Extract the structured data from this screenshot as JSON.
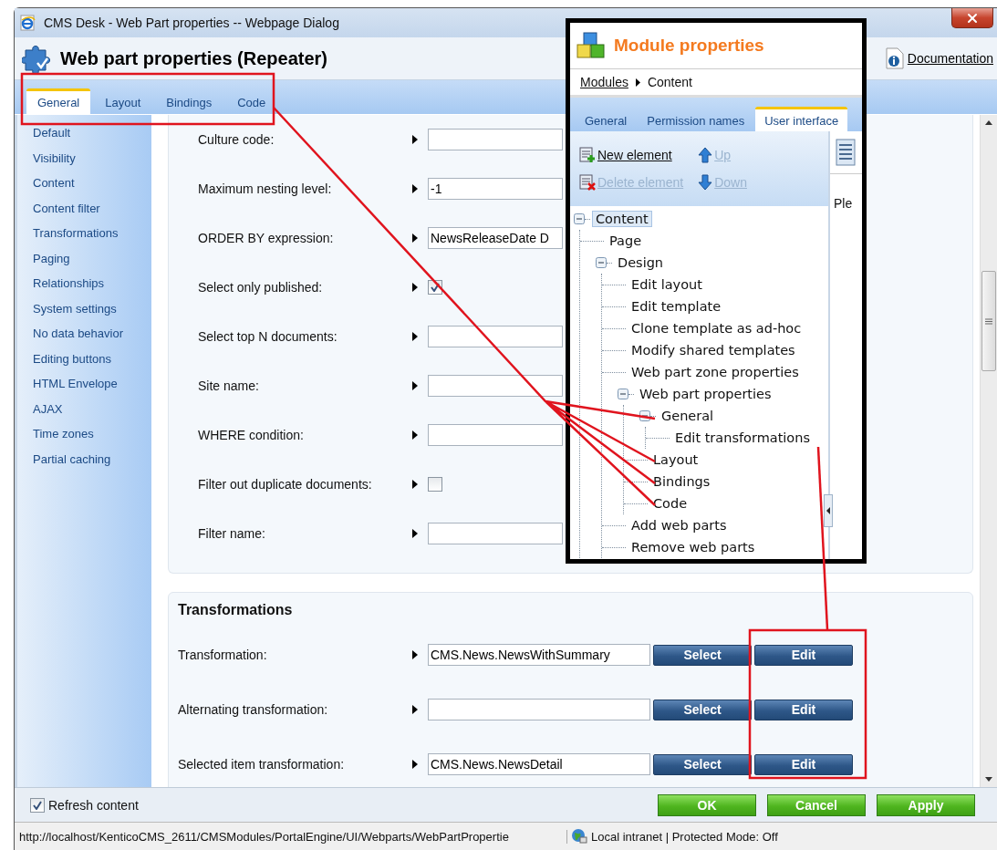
{
  "window": {
    "title": "CMS Desk - Web Part properties -- Webpage Dialog"
  },
  "header": {
    "title": "Web part properties (Repeater)",
    "help_link": "Documentation"
  },
  "tabs": [
    {
      "label": "General",
      "selected": true
    },
    {
      "label": "Layout",
      "selected": false
    },
    {
      "label": "Bindings",
      "selected": false
    },
    {
      "label": "Code",
      "selected": false
    }
  ],
  "sidebar": {
    "items": [
      "Default",
      "Visibility",
      "Content",
      "Content filter",
      "Transformations",
      "Paging",
      "Relationships",
      "System settings",
      "No data behavior",
      "Editing buttons",
      "HTML Envelope",
      "AJAX",
      "Time zones",
      "Partial caching"
    ]
  },
  "properties": [
    {
      "kind": "text",
      "label": "Culture code:"
    },
    {
      "kind": "text",
      "label": "Maximum nesting level:",
      "value": "-1"
    },
    {
      "kind": "text",
      "label": "ORDER BY expression:",
      "value": "NewsReleaseDate D"
    },
    {
      "kind": "checkbox",
      "label": "Select only published:",
      "checked": true
    },
    {
      "kind": "text",
      "label": "Select top N documents:"
    },
    {
      "kind": "text",
      "label": "Site name:"
    },
    {
      "kind": "text",
      "label": "WHERE condition:"
    },
    {
      "kind": "checkbox",
      "label": "Filter out duplicate documents:",
      "checked": false
    },
    {
      "kind": "text",
      "label": "Filter name:"
    }
  ],
  "transformations": {
    "title": "Transformations",
    "rows": [
      {
        "label": "Transformation:",
        "value": "CMS.News.NewsWithSummary",
        "select_button": "Select",
        "edit_button": "Edit"
      },
      {
        "label": "Alternating transformation:",
        "select_button": "Select",
        "edit_button": "Edit"
      },
      {
        "label": "Selected item transformation:",
        "value": "CMS.News.NewsDetail",
        "select_button": "Select",
        "edit_button": "Edit"
      }
    ]
  },
  "footer": {
    "refresh": {
      "label": "Refresh content",
      "checked": true
    },
    "buttons": [
      "OK",
      "Cancel",
      "Apply"
    ]
  },
  "status_bar": {
    "url": "http://localhost/KenticoCMS_2611/CMSModules/PortalEngine/UI/Webparts/WebPartPropertie",
    "zone": "Local intranet | Protected Mode: Off"
  },
  "inset": {
    "title": "Module properties",
    "breadcrumb": [
      "Modules",
      "Content"
    ],
    "tabs": [
      {
        "label": "General",
        "selected": false
      },
      {
        "label": "Permission names",
        "selected": false
      },
      {
        "label": "User interface",
        "selected": true
      }
    ],
    "toolbar": [
      {
        "kind": "new",
        "label": "New element",
        "disabled": false
      },
      {
        "kind": "up",
        "label": "Up",
        "disabled": true
      },
      {
        "kind": "delete",
        "label": "Delete element",
        "disabled": true
      },
      {
        "kind": "down",
        "label": "Down",
        "disabled": true
      }
    ],
    "tree": [
      {
        "label": "Content",
        "selected": true,
        "expanded": true,
        "children": [
          {
            "label": "Page",
            "selected": false
          },
          {
            "label": "Design",
            "selected": false,
            "expanded": true,
            "children": [
              {
                "label": "Edit layout",
                "selected": false
              },
              {
                "label": "Edit template",
                "selected": false
              },
              {
                "label": "Clone template as ad-hoc",
                "selected": false
              },
              {
                "label": "Modify shared templates",
                "selected": false
              },
              {
                "label": "Web part zone properties",
                "selected": false
              },
              {
                "label": "Web part properties",
                "selected": false,
                "expanded": true,
                "children": [
                  {
                    "label": "General",
                    "selected": false,
                    "expanded": true,
                    "children": [
                      {
                        "label": "Edit transformations",
                        "selected": false
                      }
                    ]
                  },
                  {
                    "label": "Layout",
                    "selected": false
                  },
                  {
                    "label": "Bindings",
                    "selected": false
                  },
                  {
                    "label": "Code",
                    "selected": false
                  }
                ]
              },
              {
                "label": "Add web parts",
                "selected": false
              },
              {
                "label": "Remove web parts",
                "selected": false
              }
            ]
          }
        ]
      }
    ],
    "detail_text": "Ple"
  }
}
